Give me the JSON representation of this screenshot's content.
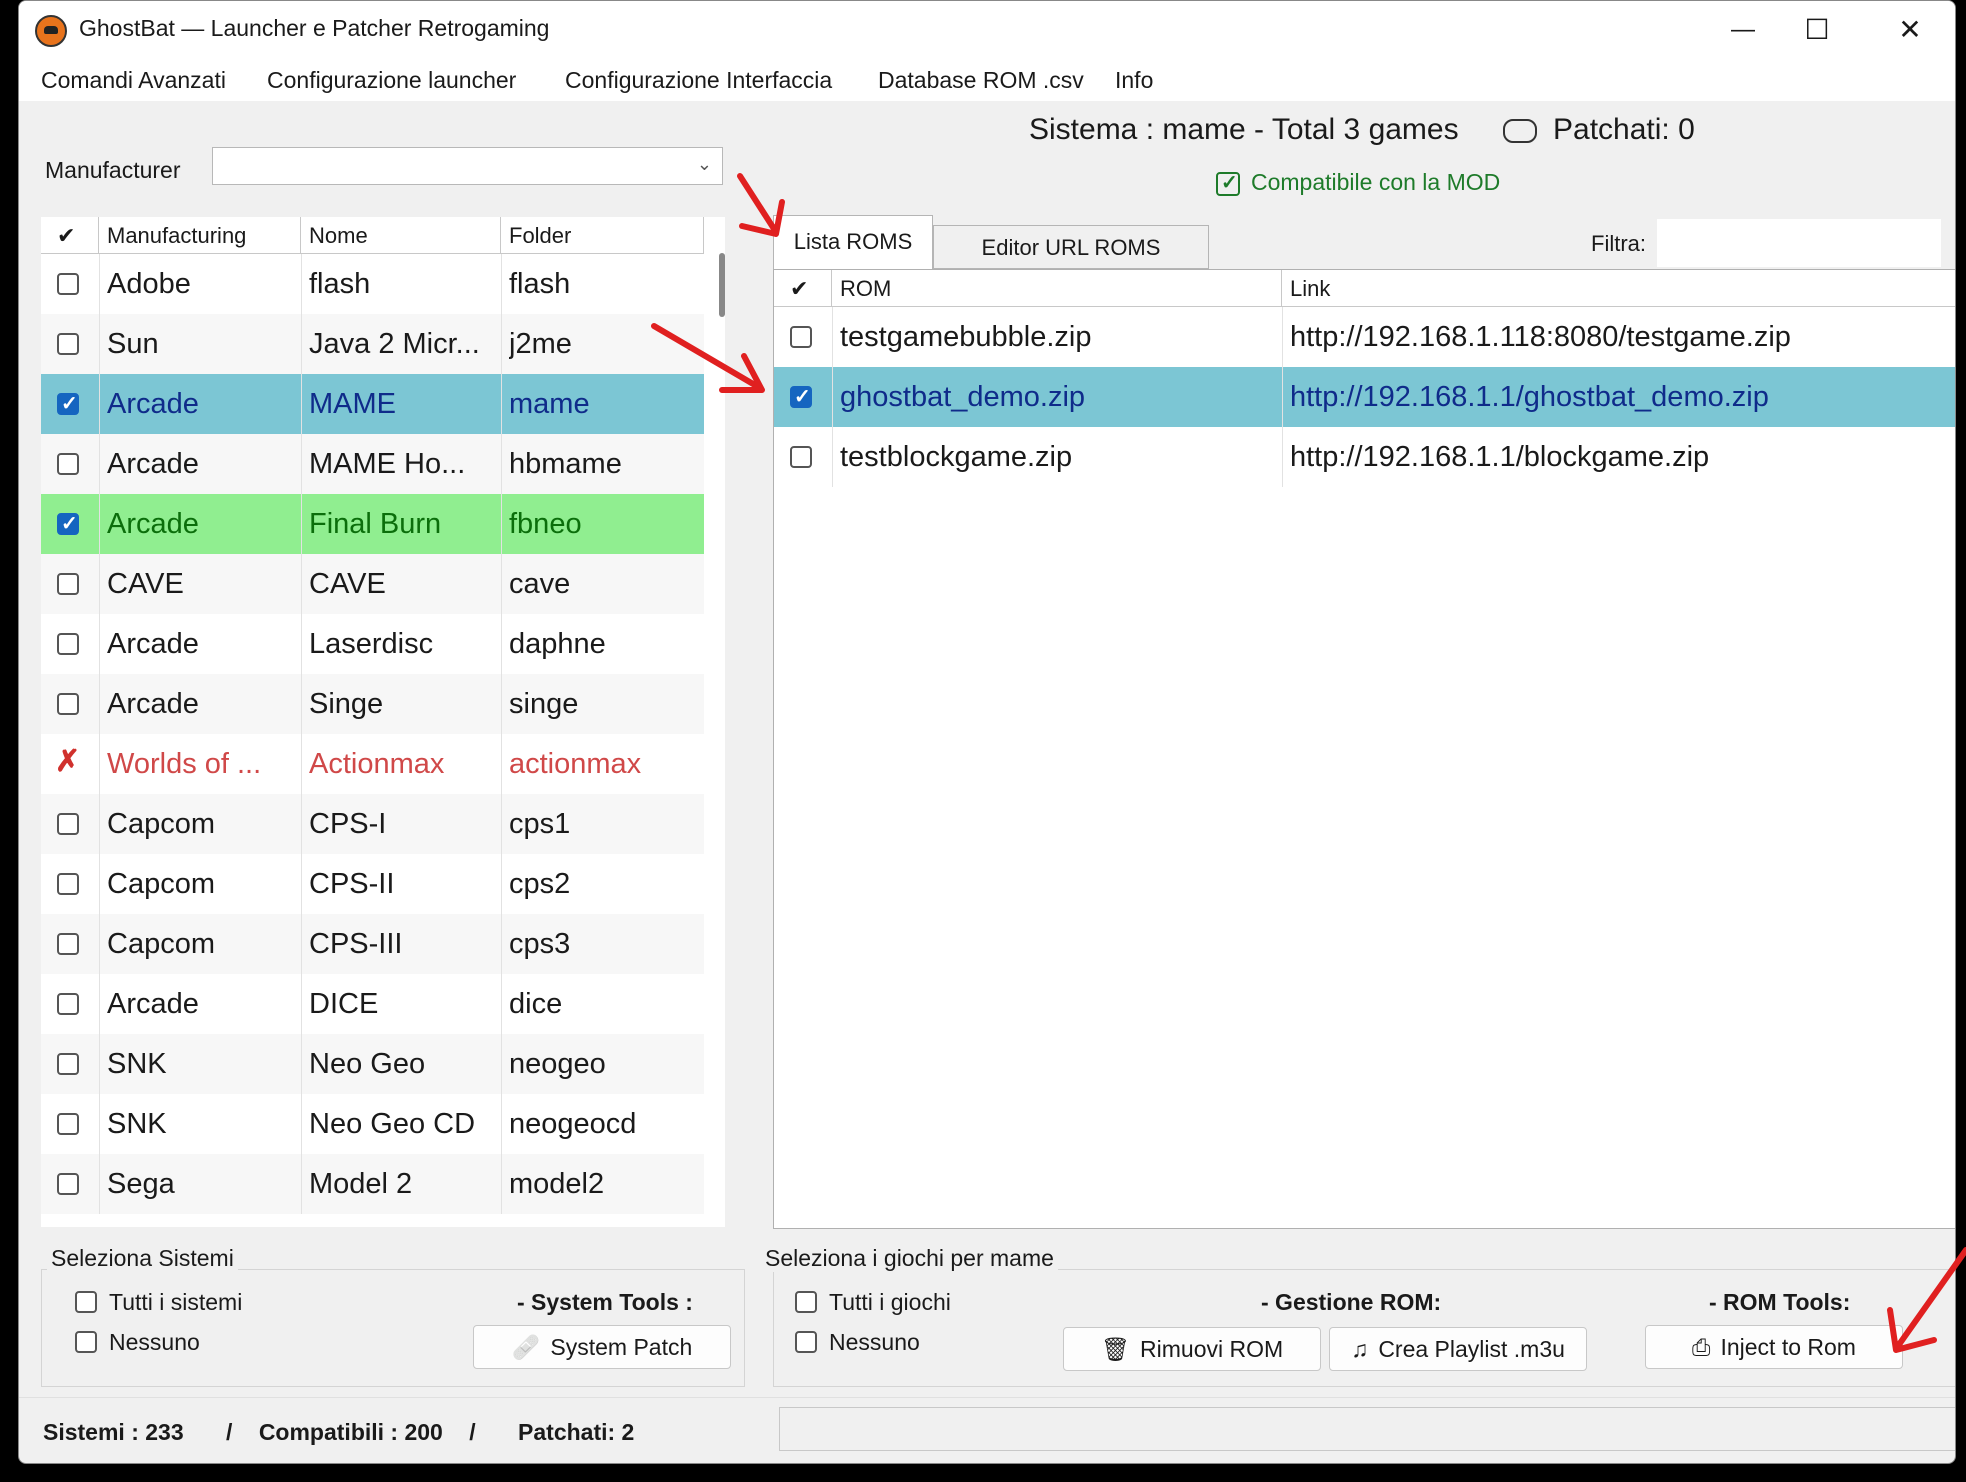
{
  "window": {
    "title": "GhostBat — Launcher e Patcher Retrogaming",
    "minimize": "—",
    "maximize": "☐",
    "close": "✕"
  },
  "menu": [
    "Comandi Avanzati",
    "Configurazione launcher",
    "Configurazione Interfaccia",
    "Database ROM .csv",
    "Info"
  ],
  "left": {
    "manufacturer_label": "Manufacturer",
    "manufacturer_value": "",
    "columns": [
      "Manufacturing",
      "Nome",
      "Folder"
    ],
    "header_check": "✔",
    "rows": [
      {
        "state": "unchecked",
        "manufacturing": "Adobe",
        "nome": "flash",
        "folder": "flash",
        "style": "normal"
      },
      {
        "state": "unchecked",
        "manufacturing": "Sun",
        "nome": "Java 2 Micr...",
        "folder": "j2me",
        "style": "alt"
      },
      {
        "state": "checked",
        "manufacturing": "Arcade",
        "nome": "MAME",
        "folder": "mame",
        "style": "selected"
      },
      {
        "state": "unchecked",
        "manufacturing": "Arcade",
        "nome": "MAME Ho...",
        "folder": "hbmame",
        "style": "alt"
      },
      {
        "state": "checked",
        "manufacturing": "Arcade",
        "nome": "Final Burn",
        "folder": "fbneo",
        "style": "green"
      },
      {
        "state": "unchecked",
        "manufacturing": "CAVE",
        "nome": "CAVE",
        "folder": "cave",
        "style": "alt"
      },
      {
        "state": "unchecked",
        "manufacturing": "Arcade",
        "nome": "Laserdisc",
        "folder": "daphne",
        "style": "normal"
      },
      {
        "state": "unchecked",
        "manufacturing": "Arcade",
        "nome": "Singe",
        "folder": "singe",
        "style": "alt"
      },
      {
        "state": "x",
        "manufacturing": "Worlds of ...",
        "nome": "Actionmax",
        "folder": "actionmax",
        "style": "red"
      },
      {
        "state": "unchecked",
        "manufacturing": "Capcom",
        "nome": "CPS-I",
        "folder": "cps1",
        "style": "alt"
      },
      {
        "state": "unchecked",
        "manufacturing": "Capcom",
        "nome": "CPS-II",
        "folder": "cps2",
        "style": "normal"
      },
      {
        "state": "unchecked",
        "manufacturing": "Capcom",
        "nome": "CPS-III",
        "folder": "cps3",
        "style": "alt"
      },
      {
        "state": "unchecked",
        "manufacturing": "Arcade",
        "nome": "DICE",
        "folder": "dice",
        "style": "normal"
      },
      {
        "state": "unchecked",
        "manufacturing": "SNK",
        "nome": "Neo Geo",
        "folder": "neogeo",
        "style": "alt"
      },
      {
        "state": "unchecked",
        "manufacturing": "SNK",
        "nome": "Neo Geo CD",
        "folder": "neogeocd",
        "style": "normal"
      },
      {
        "state": "unchecked",
        "manufacturing": "Sega",
        "nome": "Model 2",
        "folder": "model2",
        "style": "alt"
      }
    ]
  },
  "right": {
    "system_title": "Sistema : mame  - Total 3 games",
    "patched": "Patchati: 0",
    "compatible": "Compatibile con la MOD",
    "tabs": [
      "Lista ROMS",
      "Editor URL ROMS"
    ],
    "filter_label": "Filtra:",
    "filter_value": "",
    "columns": [
      "ROM",
      "Link"
    ],
    "header_check": "✔",
    "rows": [
      {
        "state": "unchecked",
        "rom": "testgamebubble.zip",
        "link": "http://192.168.1.118:8080/testgame.zip",
        "style": "normal"
      },
      {
        "state": "checked",
        "rom": "ghostbat_demo.zip",
        "link": "http://192.168.1.1/ghostbat_demo.zip",
        "style": "selected"
      },
      {
        "state": "unchecked",
        "rom": "testblockgame.zip",
        "link": "http://192.168.1.1/blockgame.zip",
        "style": "normal"
      }
    ]
  },
  "bottom": {
    "systems_group": "Seleziona Sistemi",
    "all_systems": "Tutti i sistemi",
    "none_systems": "Nessuno",
    "system_tools_label": "- System Tools :",
    "system_patch": "System Patch",
    "games_group": "Seleziona i giochi per mame",
    "all_games": "Tutti i giochi",
    "none_games": "Nessuno",
    "rom_mgmt_label": "- Gestione ROM:",
    "remove_rom": "Rimuovi ROM",
    "create_playlist": "Crea Playlist .m3u",
    "rom_tools_label": "- ROM Tools:",
    "inject": "Inject to Rom"
  },
  "status": {
    "sistemi": "Sistemi : 233",
    "sep1": "/",
    "compatibili": "Compatibili : 200",
    "sep2": "/",
    "patchati": "Patchati: 2"
  },
  "colors": {
    "selected_row": "#7cc6d4",
    "selected_text": "#0f2b8a",
    "green_row": "#90ee90",
    "green_text": "#0b6e0b",
    "red_text": "#d04848",
    "arrow": "#e02020"
  }
}
